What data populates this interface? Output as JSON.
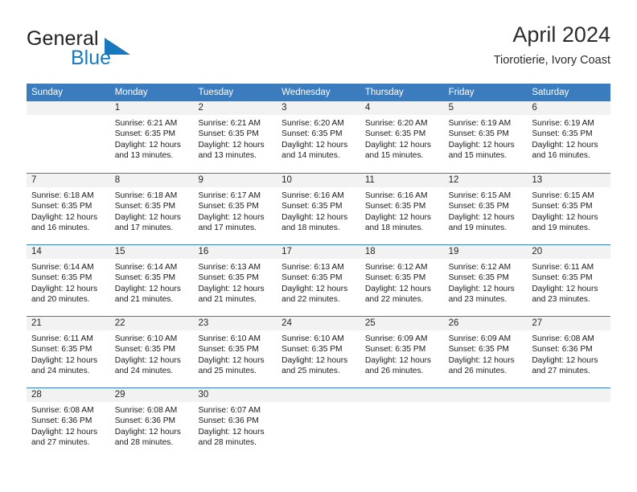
{
  "brand": {
    "name_part1": "General",
    "name_part2": "Blue",
    "triangle_icon": "triangle-icon",
    "accent_color": "#1878be"
  },
  "header": {
    "title": "April 2024",
    "subtitle": "Tiorotierie, Ivory Coast"
  },
  "theme": {
    "header_row_color": "#3a7cbe",
    "daynum_band_color": "#f2f2f2",
    "separator_color": "#3a7cbe",
    "text_color": "#1a1a1a"
  },
  "weekdays": [
    "Sunday",
    "Monday",
    "Tuesday",
    "Wednesday",
    "Thursday",
    "Friday",
    "Saturday"
  ],
  "weeks": [
    {
      "days": [
        {
          "day": "",
          "lines": [
            "",
            "",
            "",
            ""
          ],
          "empty": true
        },
        {
          "day": "1",
          "lines": [
            "Sunrise: 6:21 AM",
            "Sunset: 6:35 PM",
            "Daylight: 12 hours",
            "and 13 minutes."
          ]
        },
        {
          "day": "2",
          "lines": [
            "Sunrise: 6:21 AM",
            "Sunset: 6:35 PM",
            "Daylight: 12 hours",
            "and 13 minutes."
          ]
        },
        {
          "day": "3",
          "lines": [
            "Sunrise: 6:20 AM",
            "Sunset: 6:35 PM",
            "Daylight: 12 hours",
            "and 14 minutes."
          ]
        },
        {
          "day": "4",
          "lines": [
            "Sunrise: 6:20 AM",
            "Sunset: 6:35 PM",
            "Daylight: 12 hours",
            "and 15 minutes."
          ]
        },
        {
          "day": "5",
          "lines": [
            "Sunrise: 6:19 AM",
            "Sunset: 6:35 PM",
            "Daylight: 12 hours",
            "and 15 minutes."
          ]
        },
        {
          "day": "6",
          "lines": [
            "Sunrise: 6:19 AM",
            "Sunset: 6:35 PM",
            "Daylight: 12 hours",
            "and 16 minutes."
          ]
        }
      ]
    },
    {
      "days": [
        {
          "day": "7",
          "lines": [
            "Sunrise: 6:18 AM",
            "Sunset: 6:35 PM",
            "Daylight: 12 hours",
            "and 16 minutes."
          ]
        },
        {
          "day": "8",
          "lines": [
            "Sunrise: 6:18 AM",
            "Sunset: 6:35 PM",
            "Daylight: 12 hours",
            "and 17 minutes."
          ]
        },
        {
          "day": "9",
          "lines": [
            "Sunrise: 6:17 AM",
            "Sunset: 6:35 PM",
            "Daylight: 12 hours",
            "and 17 minutes."
          ]
        },
        {
          "day": "10",
          "lines": [
            "Sunrise: 6:16 AM",
            "Sunset: 6:35 PM",
            "Daylight: 12 hours",
            "and 18 minutes."
          ]
        },
        {
          "day": "11",
          "lines": [
            "Sunrise: 6:16 AM",
            "Sunset: 6:35 PM",
            "Daylight: 12 hours",
            "and 18 minutes."
          ]
        },
        {
          "day": "12",
          "lines": [
            "Sunrise: 6:15 AM",
            "Sunset: 6:35 PM",
            "Daylight: 12 hours",
            "and 19 minutes."
          ]
        },
        {
          "day": "13",
          "lines": [
            "Sunrise: 6:15 AM",
            "Sunset: 6:35 PM",
            "Daylight: 12 hours",
            "and 19 minutes."
          ]
        }
      ]
    },
    {
      "days": [
        {
          "day": "14",
          "lines": [
            "Sunrise: 6:14 AM",
            "Sunset: 6:35 PM",
            "Daylight: 12 hours",
            "and 20 minutes."
          ]
        },
        {
          "day": "15",
          "lines": [
            "Sunrise: 6:14 AM",
            "Sunset: 6:35 PM",
            "Daylight: 12 hours",
            "and 21 minutes."
          ]
        },
        {
          "day": "16",
          "lines": [
            "Sunrise: 6:13 AM",
            "Sunset: 6:35 PM",
            "Daylight: 12 hours",
            "and 21 minutes."
          ]
        },
        {
          "day": "17",
          "lines": [
            "Sunrise: 6:13 AM",
            "Sunset: 6:35 PM",
            "Daylight: 12 hours",
            "and 22 minutes."
          ]
        },
        {
          "day": "18",
          "lines": [
            "Sunrise: 6:12 AM",
            "Sunset: 6:35 PM",
            "Daylight: 12 hours",
            "and 22 minutes."
          ]
        },
        {
          "day": "19",
          "lines": [
            "Sunrise: 6:12 AM",
            "Sunset: 6:35 PM",
            "Daylight: 12 hours",
            "and 23 minutes."
          ]
        },
        {
          "day": "20",
          "lines": [
            "Sunrise: 6:11 AM",
            "Sunset: 6:35 PM",
            "Daylight: 12 hours",
            "and 23 minutes."
          ]
        }
      ]
    },
    {
      "days": [
        {
          "day": "21",
          "lines": [
            "Sunrise: 6:11 AM",
            "Sunset: 6:35 PM",
            "Daylight: 12 hours",
            "and 24 minutes."
          ]
        },
        {
          "day": "22",
          "lines": [
            "Sunrise: 6:10 AM",
            "Sunset: 6:35 PM",
            "Daylight: 12 hours",
            "and 24 minutes."
          ]
        },
        {
          "day": "23",
          "lines": [
            "Sunrise: 6:10 AM",
            "Sunset: 6:35 PM",
            "Daylight: 12 hours",
            "and 25 minutes."
          ]
        },
        {
          "day": "24",
          "lines": [
            "Sunrise: 6:10 AM",
            "Sunset: 6:35 PM",
            "Daylight: 12 hours",
            "and 25 minutes."
          ]
        },
        {
          "day": "25",
          "lines": [
            "Sunrise: 6:09 AM",
            "Sunset: 6:35 PM",
            "Daylight: 12 hours",
            "and 26 minutes."
          ]
        },
        {
          "day": "26",
          "lines": [
            "Sunrise: 6:09 AM",
            "Sunset: 6:35 PM",
            "Daylight: 12 hours",
            "and 26 minutes."
          ]
        },
        {
          "day": "27",
          "lines": [
            "Sunrise: 6:08 AM",
            "Sunset: 6:36 PM",
            "Daylight: 12 hours",
            "and 27 minutes."
          ]
        }
      ]
    },
    {
      "days": [
        {
          "day": "28",
          "lines": [
            "Sunrise: 6:08 AM",
            "Sunset: 6:36 PM",
            "Daylight: 12 hours",
            "and 27 minutes."
          ]
        },
        {
          "day": "29",
          "lines": [
            "Sunrise: 6:08 AM",
            "Sunset: 6:36 PM",
            "Daylight: 12 hours",
            "and 28 minutes."
          ]
        },
        {
          "day": "30",
          "lines": [
            "Sunrise: 6:07 AM",
            "Sunset: 6:36 PM",
            "Daylight: 12 hours",
            "and 28 minutes."
          ]
        },
        {
          "day": "",
          "lines": [
            "",
            "",
            "",
            ""
          ],
          "empty": true
        },
        {
          "day": "",
          "lines": [
            "",
            "",
            "",
            ""
          ],
          "empty": true
        },
        {
          "day": "",
          "lines": [
            "",
            "",
            "",
            ""
          ],
          "empty": true
        },
        {
          "day": "",
          "lines": [
            "",
            "",
            "",
            ""
          ],
          "empty": true
        }
      ]
    }
  ]
}
